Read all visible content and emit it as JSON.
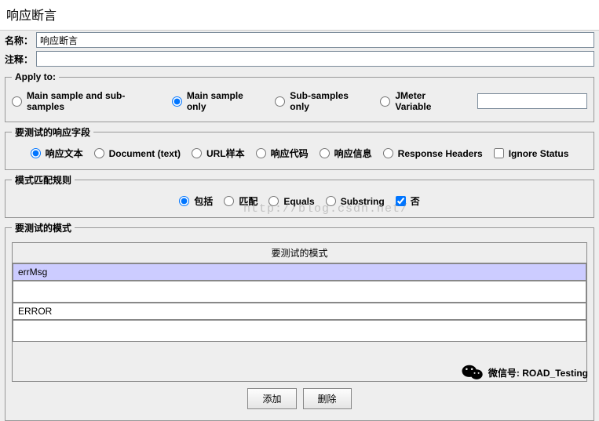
{
  "title": "响应断言",
  "name_label": "名称：",
  "name_value": "响应断言",
  "comment_label": "注释：",
  "comment_value": "",
  "apply": {
    "legend": "Apply to:",
    "options": [
      {
        "label": "Main sample and sub-samples",
        "checked": false
      },
      {
        "label": "Main sample only",
        "checked": true
      },
      {
        "label": "Sub-samples only",
        "checked": false
      },
      {
        "label": "JMeter Variable",
        "checked": false
      }
    ],
    "var_value": ""
  },
  "response_field": {
    "legend": "要测试的响应字段",
    "options": [
      {
        "label": "响应文本",
        "checked": true
      },
      {
        "label": "Document (text)",
        "checked": false
      },
      {
        "label": "URL样本",
        "checked": false
      },
      {
        "label": "响应代码",
        "checked": false
      },
      {
        "label": "响应信息",
        "checked": false
      },
      {
        "label": "Response Headers",
        "checked": false
      }
    ],
    "ignore_status_label": "Ignore Status",
    "ignore_status_checked": false
  },
  "matching_rule": {
    "legend": "模式匹配规则",
    "options": [
      {
        "label": "包括",
        "checked": true
      },
      {
        "label": "匹配",
        "checked": false
      },
      {
        "label": "Equals",
        "checked": false
      },
      {
        "label": "Substring",
        "checked": false
      }
    ],
    "not_label": "否",
    "not_checked": true
  },
  "patterns": {
    "legend": "要测试的模式",
    "header": "要测试的模式",
    "rows": [
      "errMsg",
      "ERROR"
    ]
  },
  "buttons": {
    "add": "添加",
    "delete": "删除"
  },
  "watermark": "http://blog.csdn.net/",
  "wechat_label": "微信号: ROAD_Testing"
}
